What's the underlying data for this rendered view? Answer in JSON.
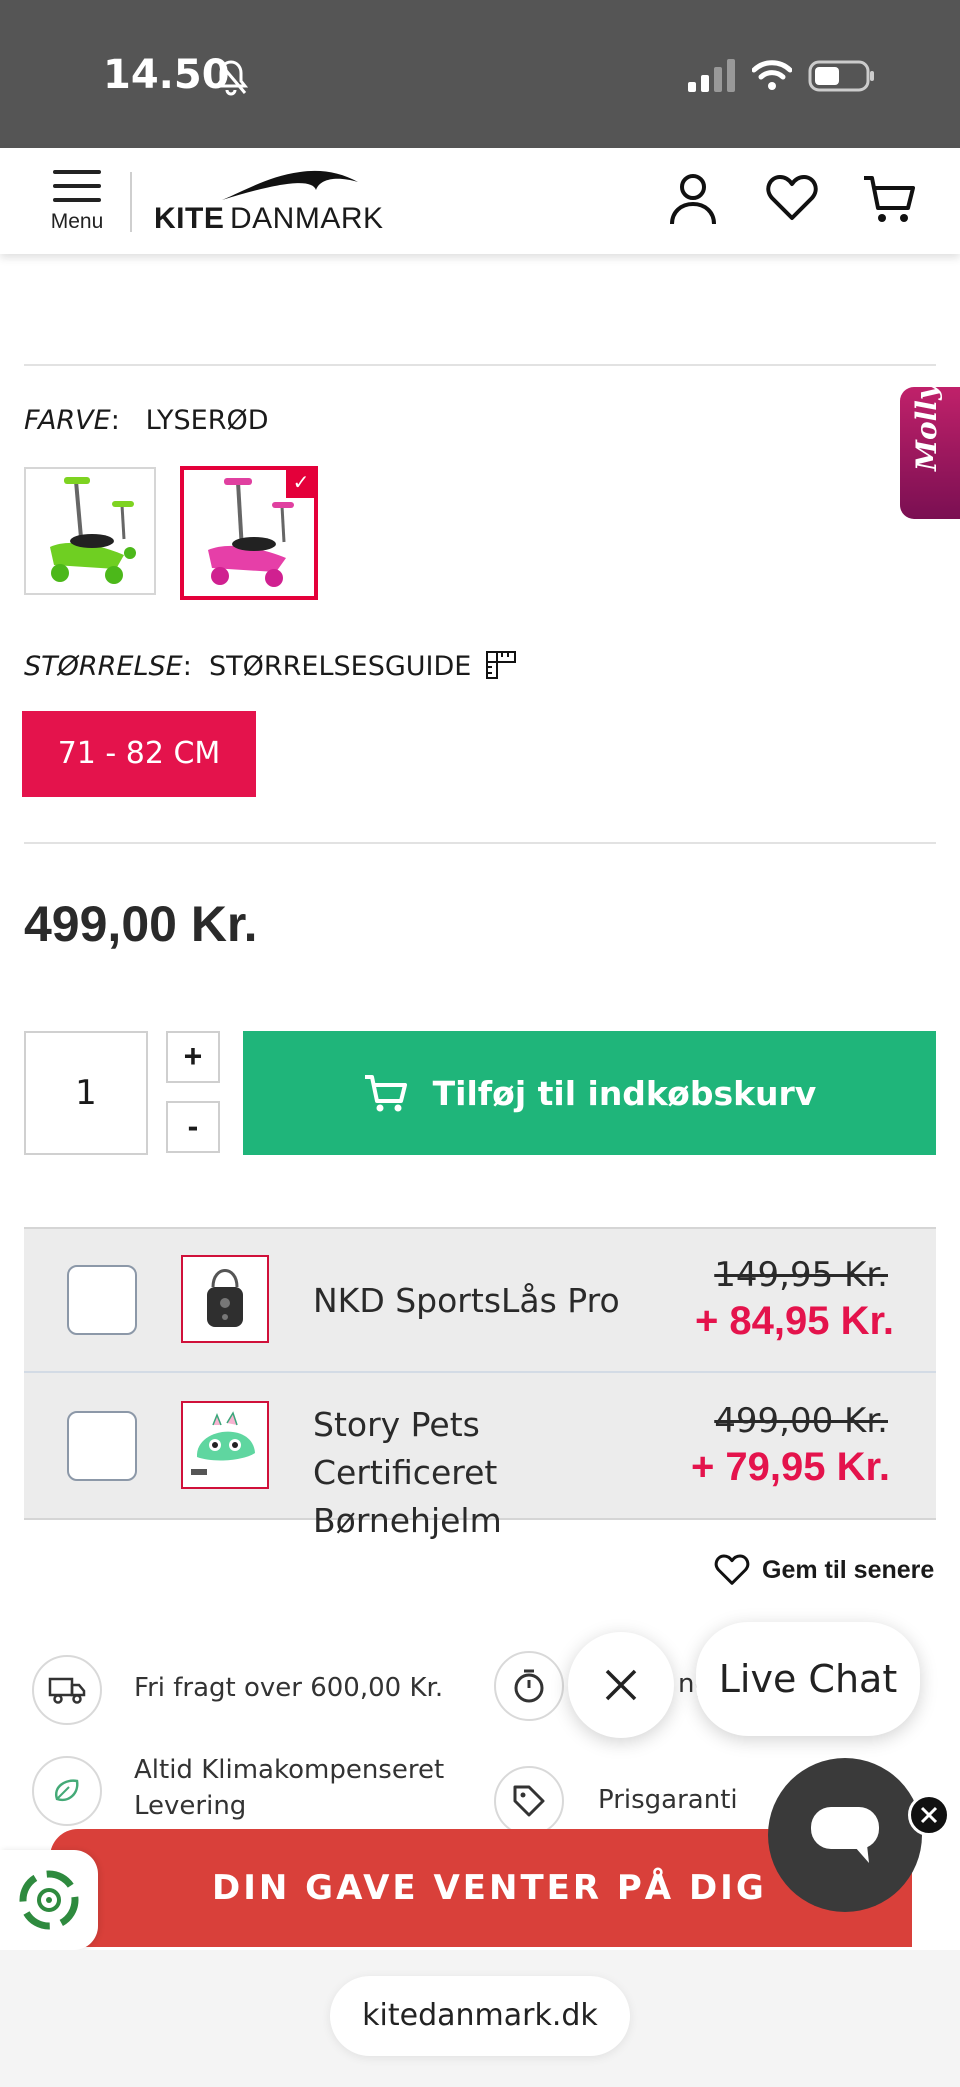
{
  "status_bar": {
    "time": "14.50"
  },
  "header": {
    "menu_label": "Menu",
    "logo_kite": "KITE",
    "logo_danmark": "DANMARK"
  },
  "product": {
    "color_label": "FARVE",
    "color_value": "LYSERØD",
    "size_label": "STØRRELSE",
    "size_guide": "STØRRELSESGUIDE",
    "selected_size": "71 - 82 CM",
    "price": "499,00 Kr."
  },
  "cart": {
    "quantity": "1",
    "plus": "+",
    "minus": "-",
    "add_label": "Tilføj til indkøbskurv"
  },
  "bundle": [
    {
      "name": "NKD SportsLås Pro",
      "old_price": "149,95 Kr.",
      "new_price": "+ 84,95 Kr."
    },
    {
      "name": "Story Pets Certificeret Børnehjelm",
      "old_price": "499,00 Kr.",
      "new_price": "+ 79,95 Kr."
    }
  ],
  "save_later": "Gem til senere",
  "usps": {
    "shipping": "Fri fragt over 600,00 Kr.",
    "climate": "Altid Klimakompenseret Levering",
    "delivery_partial": "ng",
    "price_guarantee": "Prisgaranti"
  },
  "molly": "Molly",
  "chat": {
    "live_chat": "Live Chat"
  },
  "promo": {
    "banner": "DIN GAVE VENTER PÅ DIG"
  },
  "browser": {
    "url": "kitedanmark.dk"
  },
  "colors": {
    "accent_red": "#e4134c",
    "cta_green": "#1fb57a",
    "banner_red": "#d9403a"
  }
}
